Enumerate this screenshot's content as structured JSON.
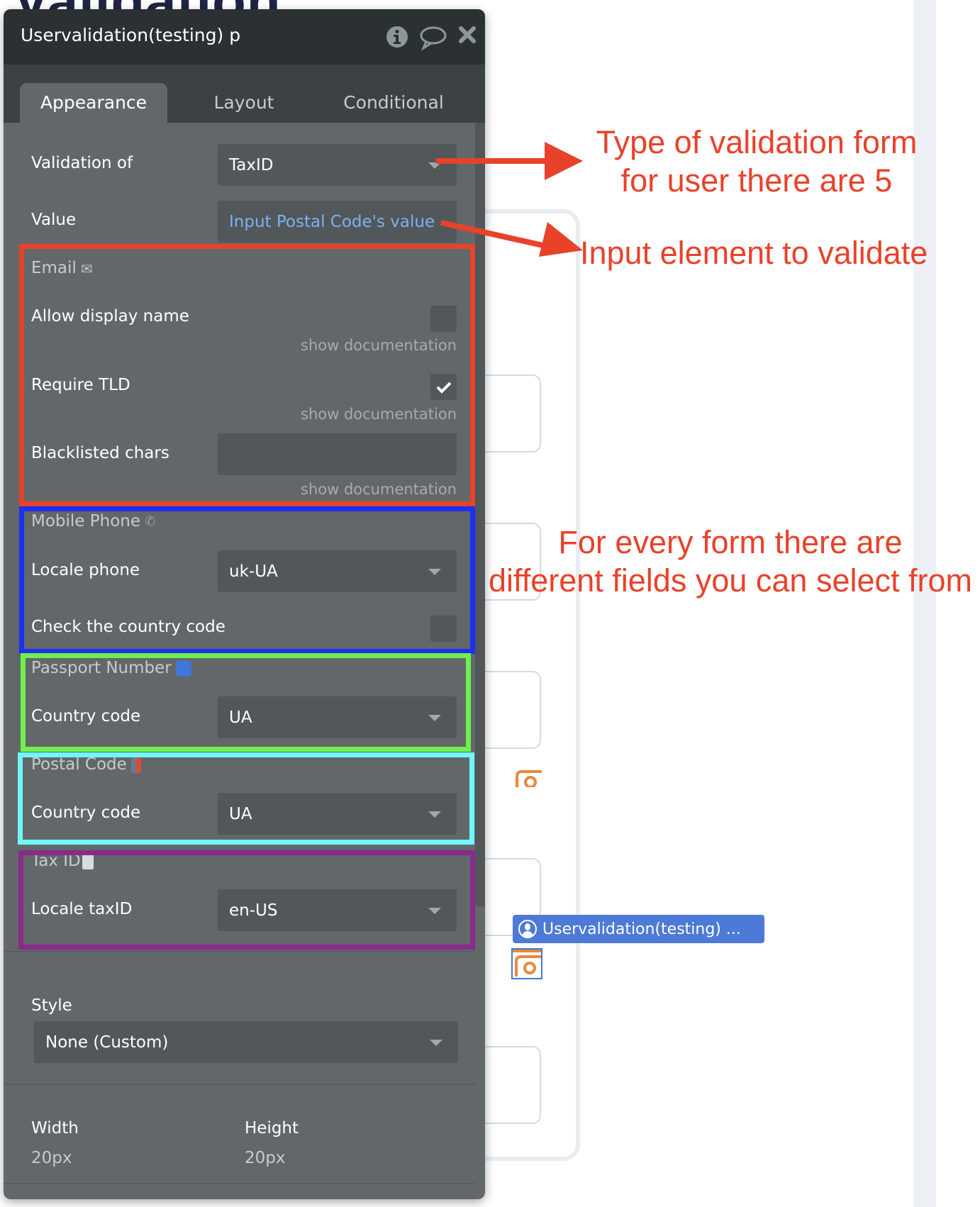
{
  "background": {
    "heading": "Validation",
    "element_tag": "Uservalidation(testing) ..."
  },
  "panel": {
    "title": "Uservalidation(testing) p",
    "header_icons": [
      "info-icon",
      "comment-icon",
      "close-icon"
    ],
    "tabs": [
      {
        "label": "Appearance",
        "active": true
      },
      {
        "label": "Layout",
        "active": false
      },
      {
        "label": "Conditional",
        "active": false
      }
    ],
    "validation_of": {
      "label": "Validation of",
      "value": "TaxID"
    },
    "value": {
      "label": "Value",
      "value": "Input Postal Code's value"
    },
    "sections": {
      "email": {
        "title": "Email",
        "icon": "✉",
        "allow_display_name": {
          "label": "Allow display name",
          "checked": false,
          "doc": "show documentation"
        },
        "require_tld": {
          "label": "Require TLD",
          "checked": true,
          "doc": "show documentation"
        },
        "blacklisted_chars": {
          "label": "Blacklisted chars",
          "value": "",
          "doc": "show documentation"
        }
      },
      "mobile_phone": {
        "title": "Mobile Phone",
        "icon": "📞",
        "locale_phone": {
          "label": "Locale phone",
          "value": "uk-UA"
        },
        "check_country_code": {
          "label": "Check the country code",
          "checked": false
        }
      },
      "passport_number": {
        "title": "Passport Number",
        "icon": "🛂",
        "country_code": {
          "label": "Country code",
          "value": "UA"
        }
      },
      "postal_code": {
        "title": "Postal Code",
        "icon": "📫",
        "country_code": {
          "label": "Country code",
          "value": "UA"
        }
      },
      "tax_id": {
        "title": "Tax ID",
        "icon": "🧾",
        "locale_taxid": {
          "label": "Locale taxID",
          "value": "en-US"
        }
      }
    },
    "style": {
      "label": "Style",
      "value": "None (Custom)"
    },
    "width": {
      "label": "Width",
      "value": "20px"
    },
    "height": {
      "label": "Height",
      "value": "20px"
    }
  },
  "annotations": {
    "type_of_validation": [
      "Type of validation form",
      "for user there are 5"
    ],
    "input_element": "Input element to validate",
    "fields": [
      "For every form there are",
      "different fields you can select from"
    ]
  },
  "colors": {
    "annotation_red": "#e8422a",
    "email_box": "#e8422a",
    "mobile_box": "#1c2ff2",
    "passport_box": "#6ff04d",
    "postal_box": "#70f7f8",
    "taxid_box": "#8a2a8c",
    "link_blue": "#7bb1f2",
    "panel_bg": "#62676a",
    "header_bg": "#2b3033"
  }
}
